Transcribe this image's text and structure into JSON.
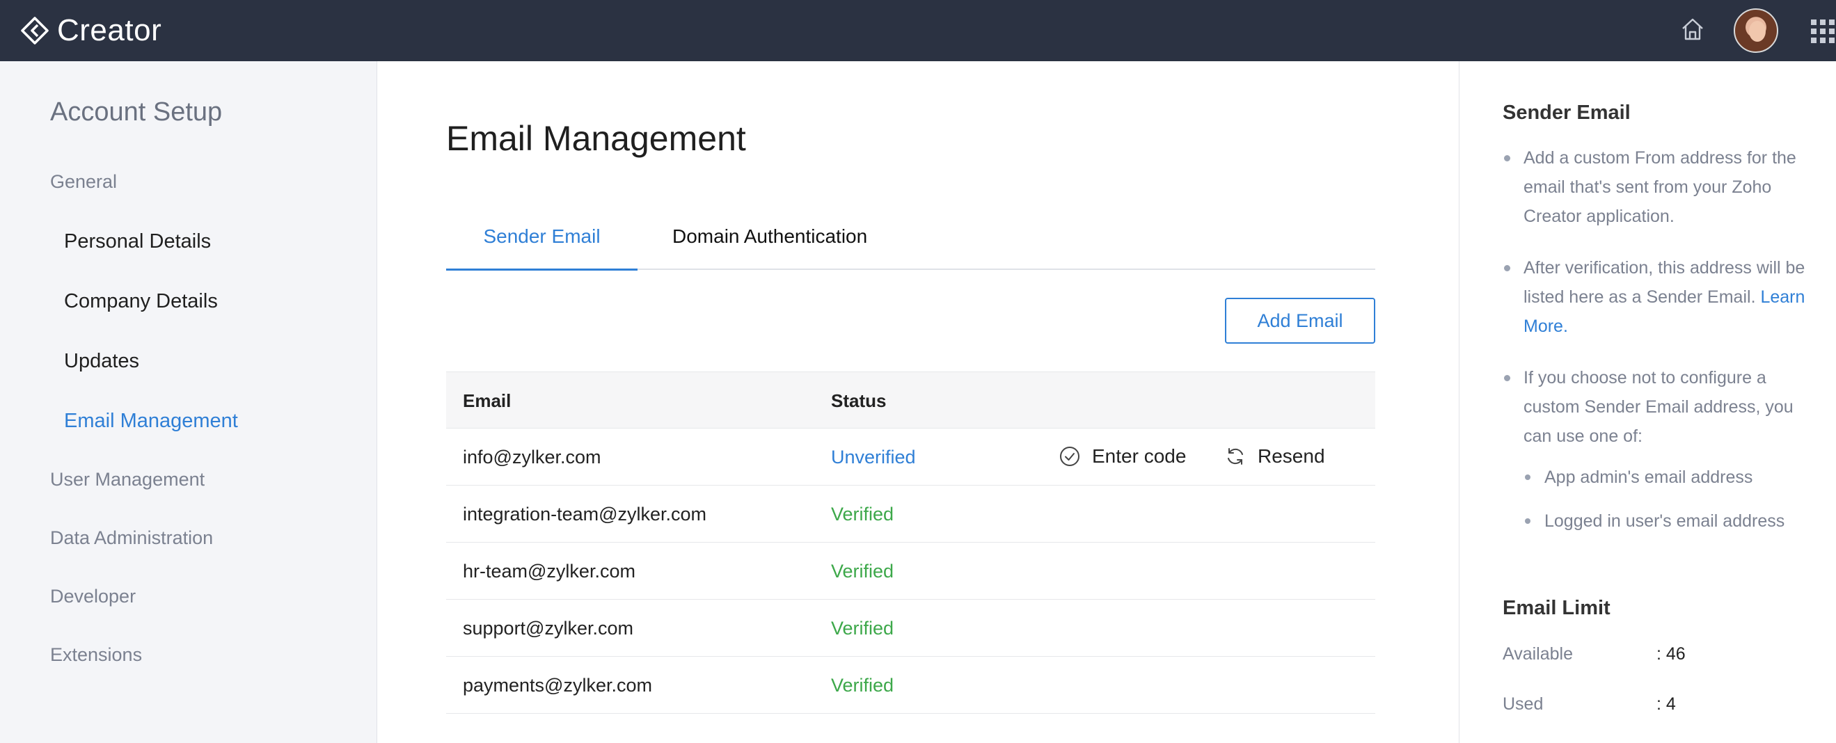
{
  "topbar": {
    "brand": "Creator",
    "icons": [
      "creator-logo-icon",
      "home-icon",
      "avatar",
      "apps-grid-icon"
    ]
  },
  "sidebar": {
    "title": "Account Setup",
    "groups": [
      "General",
      "User Management",
      "Data Administration",
      "Developer",
      "Extensions"
    ],
    "items": [
      "Personal Details",
      "Company Details",
      "Updates",
      "Email Management"
    ],
    "active_item": "Email Management"
  },
  "main": {
    "title": "Email Management",
    "tabs": [
      "Sender Email",
      "Domain Authentication"
    ],
    "active_tab": "Sender Email",
    "add_button": "Add Email",
    "table": {
      "headers": [
        "Email",
        "Status"
      ],
      "rows": [
        {
          "email": "info@zylker.com",
          "status": "Unverified"
        },
        {
          "email": "integration-team@zylker.com",
          "status": "Verified"
        },
        {
          "email": "hr-team@zylker.com",
          "status": "Verified"
        },
        {
          "email": "support@zylker.com",
          "status": "Verified"
        },
        {
          "email": "payments@zylker.com",
          "status": "Verified"
        }
      ],
      "actions": {
        "enter_code": "Enter code",
        "resend": "Resend"
      }
    }
  },
  "help": {
    "heading": "Sender Email",
    "bullets": [
      "Add a custom From address for the email that's sent from your Zoho Creator application.",
      "After verification, this address will be listed here as a Sender Email.",
      "If you choose not to configure a custom Sender Email address, you can use one of:"
    ],
    "learn_more": "Learn More.",
    "sub_bullets": [
      "App admin's email address",
      "Logged in user's email address"
    ],
    "limit_heading": "Email Limit",
    "available_label": "Available",
    "available_value": ": 46",
    "used_label": "Used",
    "used_value": ": 4"
  },
  "colors": {
    "topbar": "#2b3242",
    "accent": "#2f7fd6",
    "verified": "#3da84a",
    "sidebar_bg": "#f4f5f8"
  }
}
